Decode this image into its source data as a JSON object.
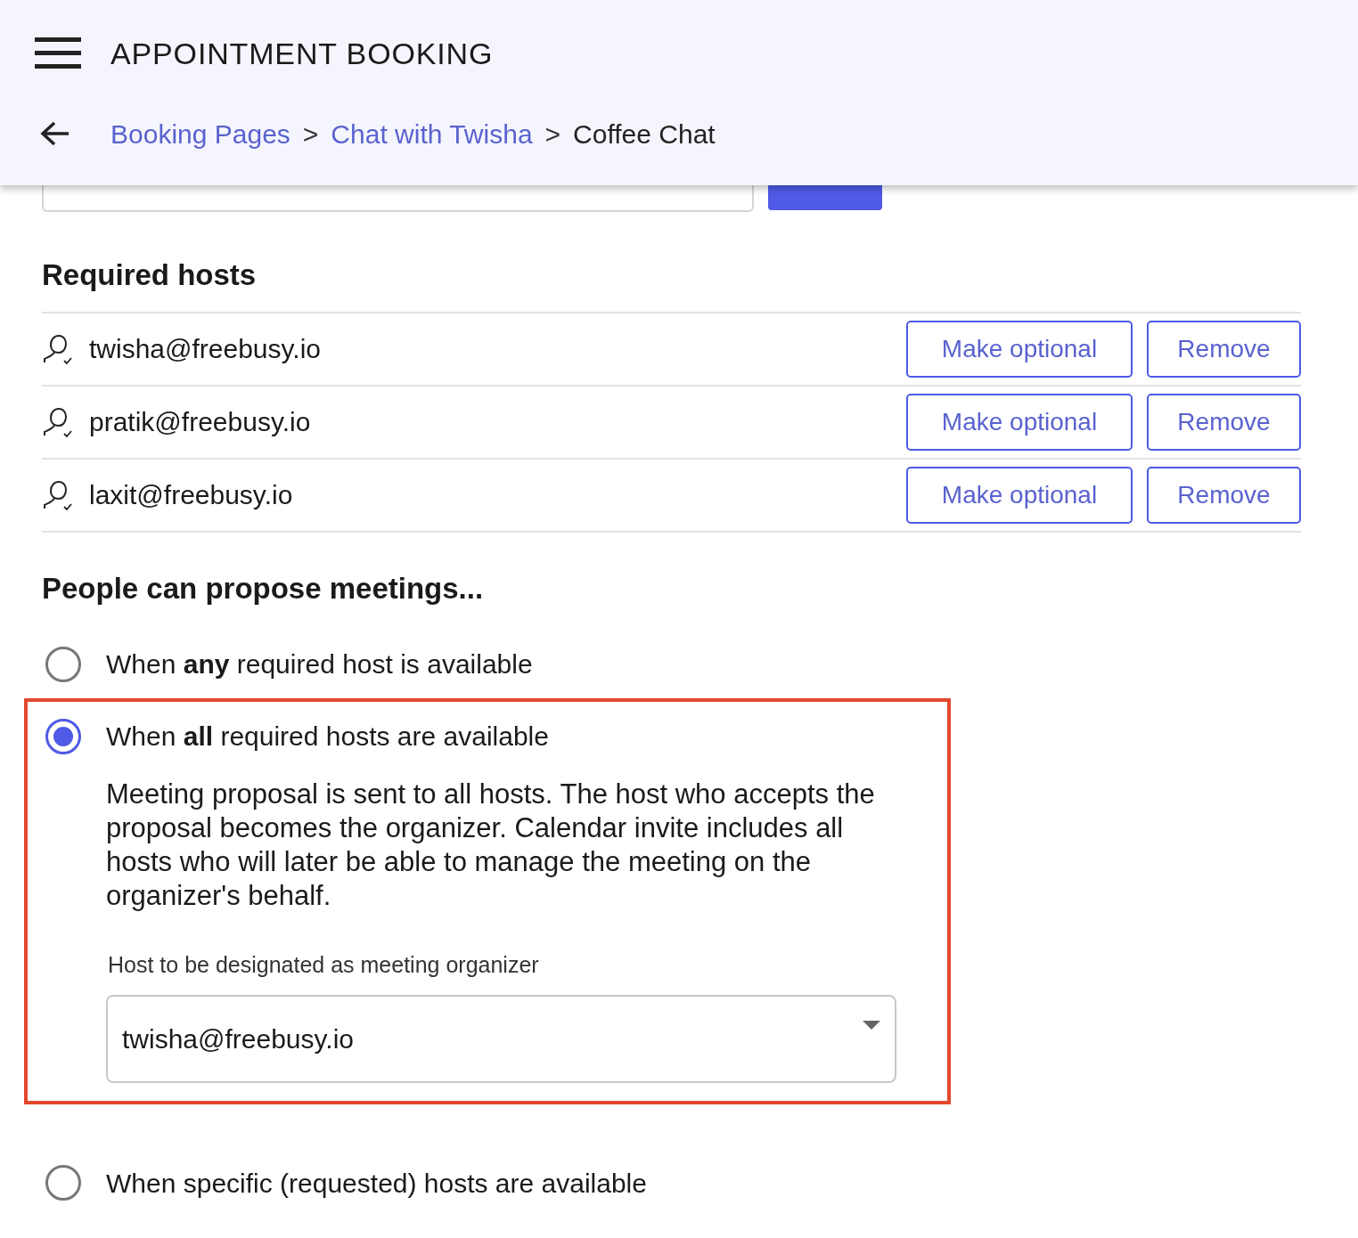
{
  "app_bar": {
    "title": "APPOINTMENT BOOKING"
  },
  "breadcrumb": [
    {
      "label": "Booking Pages",
      "kind": "link"
    },
    {
      "separator": ">",
      "label": "Chat with Twisha",
      "kind": "link"
    },
    {
      "separator": ">",
      "label": "Coffee Chat",
      "kind": "current"
    }
  ],
  "required_hosts": {
    "title": "Required hosts",
    "hosts": [
      {
        "email": "twisha@freebusy.io",
        "actions": [
          "Make optional",
          "Remove"
        ]
      },
      {
        "email": "pratik@freebusy.io",
        "actions": [
          "Make optional",
          "Remove"
        ]
      },
      {
        "email": "laxit@freebusy.io",
        "actions": [
          "Make optional",
          "Remove"
        ]
      }
    ]
  },
  "propose": {
    "title": "People can propose meetings...",
    "options": [
      {
        "label": "When **any** required host is available",
        "selected": false
      },
      {
        "label": "When **all** required hosts are available",
        "selected": true,
        "description": "Meeting proposal is sent to all hosts. The host who accepts the proposal becomes the organizer. Calendar invite includes all hosts who will later be able to manage the meeting on the organizer's behalf.",
        "organizer_field": {
          "label": "Host to be designated as meeting organizer",
          "value": "twisha@freebusy.io"
        }
      },
      {
        "label": "When specific (requested) hosts are available",
        "selected": false
      }
    ]
  }
}
